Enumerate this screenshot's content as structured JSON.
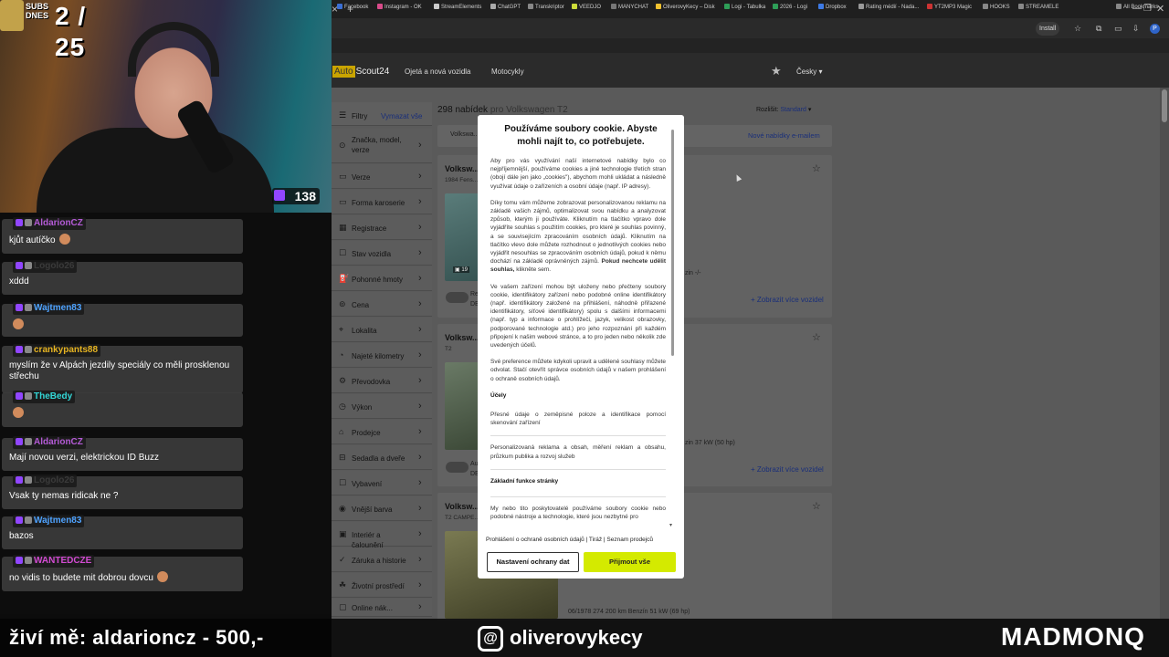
{
  "colors": {
    "accent_accept": "#d4ea00",
    "link_blue": "#1a2f7a",
    "twitch_purple": "#9146ff",
    "site_overlay": "#5a5a5a"
  },
  "browser": {
    "new_tab": "+",
    "close_tab": "×",
    "install_label": "Install",
    "profile_initial": "P",
    "all_bookmarks": "All Bookmarks",
    "bookmarks": [
      "Facebook",
      "Instagram - OK",
      "StreamElements",
      "ChatGPT",
      "Transkriptor",
      "VEEDJO",
      "MANYCHAT",
      "OliverovyKecy – Disk",
      "Logi - Tabulka",
      "2026 - Logi",
      "Dropbox",
      "Rating médií - Nada...",
      "YT2MP3 Magic",
      "HOOKS",
      "STREAMELE"
    ],
    "icons": [
      "star-icon",
      "extensions-icon",
      "tab-search-icon",
      "minimize-icon",
      "restore-icon",
      "close-icon"
    ]
  },
  "site": {
    "logo_auto": "Auto",
    "logo_scout": "Scout24",
    "nav": [
      "Ojetá a nová vozidla",
      "Motocykly"
    ],
    "language": "Česky",
    "filters_label": "Filtry",
    "clear_all": "Vymazat vše",
    "sidebar_items": [
      "Značka, model, verze",
      "Verze",
      "Forma karoserie",
      "Registrace",
      "Stav vozidla",
      "Pohonné hmoty",
      "Cena",
      "Lokalita",
      "Najeté kilometry",
      "Převodovka",
      "Výkon",
      "Prodejce",
      "Sedadla a dveře",
      "Vybavení",
      "Vnější barva",
      "Interiér a čalounění",
      "Záruka a historie",
      "Životní prostředí",
      "Online nák..."
    ],
    "results_count": "298 nabídek",
    "results_for": "pro Volkswagen T2",
    "sort_label": "Rozlišit:",
    "sort_value": "Standard",
    "search_chip": "Volkswa...",
    "new_offers": "Nové nabídky e-mailem",
    "cards": [
      {
        "title": "Volksw...",
        "sub": "1984 Fens...",
        "img_count": "19",
        "seller": "Re...",
        "seller2": "DE...",
        "meta": "zin  -/-",
        "more": "+ Zobrazit více vozidel"
      },
      {
        "title": "Volksw...",
        "sub": "T2",
        "img_count": "",
        "seller": "Au...",
        "seller2": "DE...",
        "meta": "zin  37 kW (50 hp)",
        "more": "+ Zobrazit více vozidel"
      },
      {
        "title": "Volksw...",
        "sub": "T2 CAMPE...",
        "img_count": "",
        "meta": "06/1978     274 200 km     Benzín     51 kW (69 hp)"
      }
    ]
  },
  "cookie_modal": {
    "title": "Používáme soubory cookie. Abyste mohli najít to, co potřebujete.",
    "p1": "Aby pro vás využívání naší internetové nabídky bylo co nejpříjemnější, používáme cookies a jiné technologie třetích stran (obojí dále jen jako „cookies\"), abychom mohli ukládat a následně využívat údaje o zařízeních a osobní údaje (např. IP adresy).",
    "p2_start": "Díky tomu vám můžeme zobrazovat personalizovanou reklamu na základě vašich zájmů, optimalizovat svou nabídku a analyzovat způsob, kterým ji používáte. Kliknutím na tlačítko vpravo dole vyjádříte souhlas s použitím cookies, pro které je souhlas povinný, a se souvisejícím zpracováním osobních údajů. Kliknutím na tlačítko vlevo dole můžete rozhodnout o jednotlivých cookies nebo vyjádřit nesouhlas se zpracováním osobních údajů, pokud k němu dochází na základě oprávněných zájmů.",
    "p2_bold": "Pokud nechcete udělit souhlas,",
    "p2_end": "klikněte sem.",
    "p3": "Ve vašem zařízení mohou být uloženy nebo přečteny soubory cookie, identifikátory zařízení nebo podobné online identifikátory (např. identifikátory založené na přihlášení, náhodně přiřazené identifikátory, síťové identifikátory) spolu s dalšími informacemi (např. typ a informace o prohlížeči, jazyk, velikost obrazovky, podporované technologie atd.) pro jeho rozpoznání při každém připojení k našim webové stránce, a to pro jeden nebo několik zde uvedených účelů.",
    "p4": "Své preference můžete kdykoli upravit a udělené souhlasy můžete odvolat. Stačí otevřít správce osobních údajů v našem prohlášení o ochraně osobních údajů.",
    "purposes_heading": "Účely",
    "purpose1": "Přesné údaje o zeměpisné poloze a identifikace pomocí skenování zařízení",
    "purpose2": "Personalizovaná reklama a obsah, měření reklam a obsahu, průzkum publika a rozvoj služeb",
    "basic_heading": "Základní funkce stránky",
    "basic_text": "My nebo tito poskytovatelé používáme soubory cookie nebo podobné nástroje a technologie, které jsou nezbytné pro",
    "link_privacy": "Prohlášení o ochraně osobních údajů",
    "link_imprint": "Tiráž",
    "link_partners": "Seznam prodejců",
    "btn_settings": "Nastavení ochrany dat",
    "btn_accept": "Přijmout vše"
  },
  "stream": {
    "subs_label": "SUBS\nDNES",
    "subs_count": "2 / 25",
    "viewers": "138",
    "chat": [
      {
        "user": "AldarionCZ",
        "color": "#b45bd6",
        "text": "kjůt autíčko"
      },
      {
        "user": "Logolo26",
        "color": "#3a3a3a",
        "text": "xddd"
      },
      {
        "user": "Wajtmen83",
        "color": "#4fa3ff",
        "text": ""
      },
      {
        "user": "crankypants88",
        "color": "#e6b422",
        "text": "myslím že v Alpách jezdily speciály co měli prosklenou střechu"
      },
      {
        "user": "TheBedy",
        "color": "#33d6d6",
        "text": ""
      },
      {
        "user": "AldarionCZ",
        "color": "#b45bd6",
        "text": "Mají novou verzi, elektrickou ID Buzz"
      },
      {
        "user": "Logolo26",
        "color": "#3a3a3a",
        "text": "Vsak ty nemas ridicak ne ?"
      },
      {
        "user": "Wajtmen83",
        "color": "#4fa3ff",
        "text": "bazos"
      },
      {
        "user": "WANTEDCZE",
        "color": "#d24bd2",
        "text": "no vidis to budete mit dobrou dovcu"
      }
    ],
    "footer_left": "živí mě: aldarioncz - 500,-",
    "footer_center": "oliverovykecy",
    "footer_right": "MADMONQ"
  }
}
